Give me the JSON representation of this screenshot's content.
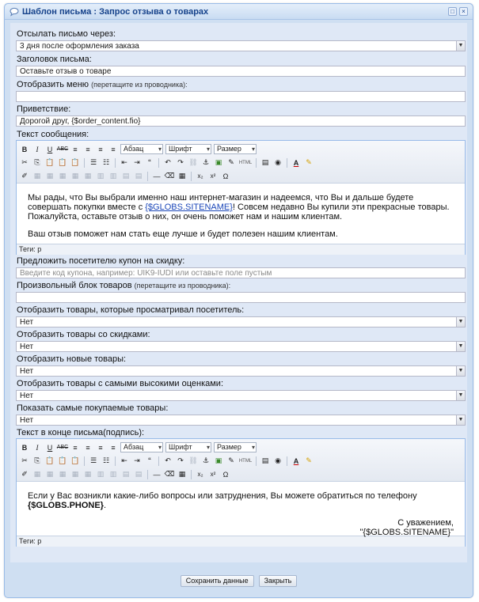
{
  "window": {
    "title": "Шаблон письма : Запрос отзыва о товарах",
    "window_icon": "bubble-icon",
    "tools": [
      "maximize-icon",
      "close-icon"
    ]
  },
  "fields": {
    "send_after": {
      "label": "Отсылать письмо через:",
      "value": "3 дня после оформления заказа"
    },
    "subject": {
      "label": "Заголовок письма:",
      "value": "Оставьте отзыв о товаре"
    },
    "menu": {
      "label": "Отобразить меню",
      "hint": "(перетащите из проводника):",
      "value": ""
    },
    "greeting": {
      "label": "Приветствие:",
      "value": "Дорогой друг, {$order_content.fio}"
    },
    "message_label": "Текст сообщения:",
    "coupon": {
      "label": "Предложить посетителю купон на скидку:",
      "placeholder": "Введите код купона, например: UIK9-IUDI или оставьте поле пустым"
    },
    "products_block": {
      "label": "Произвольный блок товаров",
      "hint": "(перетащите из проводника):",
      "value": ""
    },
    "viewed": {
      "label": "Отобразить товары, которые просматривал посетитель:",
      "value": "Нет"
    },
    "discounted": {
      "label": "Отобразить товары со скидками:",
      "value": "Нет"
    },
    "newest": {
      "label": "Отобразить новые товары:",
      "value": "Нет"
    },
    "top_rated": {
      "label": "Отобразить товары с самыми высокими оценками:",
      "value": "Нет"
    },
    "bestsellers": {
      "label": "Показать самые покупаемые товары:",
      "value": "Нет"
    },
    "signature_label": "Текст в конце письма(подпись):"
  },
  "toolbar": {
    "format_dd": "Абзац",
    "font_dd": "Шрифт",
    "size_dd": "Размер",
    "html_label": "HTML"
  },
  "editor1": {
    "p1_before": "Мы рады, что Вы выбрали именно наш интернет-магазин и надеемся, что Вы и дальше будете совершать покупки вместе с ",
    "p1_link": "{$GLOBS.SITENAME}",
    "p1_after": "! Совсем недавно Вы купили эти прекрасные товары. Пожалуйста, оставьте отзыв о них, он очень поможет нам и нашим клиентам.",
    "p2": "Ваш отзыв поможет нам стать еще лучше и будет полезен нашим клиентам.",
    "status": "Теги: p"
  },
  "editor2": {
    "p1_before": "Если у Вас возникли какие-либо вопросы или затруднения, Вы можете обратиться по телефону ",
    "p1_bold": "{$GLOBS.PHONE}",
    "p1_after": ".",
    "sig1": "С уважением,",
    "sig2": "\"{$GLOBS.SITENAME}\"",
    "status": "Теги: p"
  },
  "buttons": {
    "save": "Сохранить данные",
    "close": "Закрыть"
  }
}
